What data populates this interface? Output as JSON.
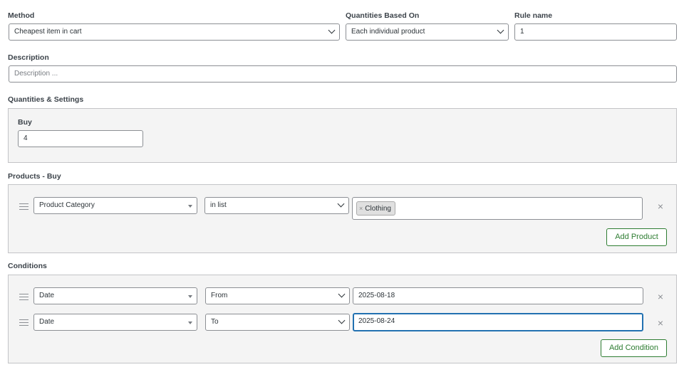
{
  "method": {
    "label": "Method",
    "value": "Cheapest item in cart"
  },
  "quantities_based_on": {
    "label": "Quantities Based On",
    "value": "Each individual product"
  },
  "rule_name": {
    "label": "Rule name",
    "value": "1"
  },
  "description": {
    "label": "Description",
    "placeholder": "Description ..."
  },
  "quantities_settings": {
    "label": "Quantities & Settings",
    "buy_label": "Buy",
    "buy_value": "4"
  },
  "products_buy": {
    "label": "Products - Buy",
    "row": {
      "type": "Product Category",
      "operator": "in list",
      "tags": [
        "Clothing"
      ]
    },
    "add_label": "Add Product"
  },
  "conditions": {
    "label": "Conditions",
    "rows": [
      {
        "type": "Date",
        "operator": "From",
        "value": "2025-08-18"
      },
      {
        "type": "Date",
        "operator": "To",
        "value": "2025-08-24"
      }
    ],
    "add_label": "Add Condition"
  },
  "icons": {
    "remove": "×",
    "tag_remove": "×"
  },
  "colors": {
    "accent_green": "#2e7d32",
    "focus_blue": "#2271b1",
    "panel_bg": "#f4f4f4"
  }
}
